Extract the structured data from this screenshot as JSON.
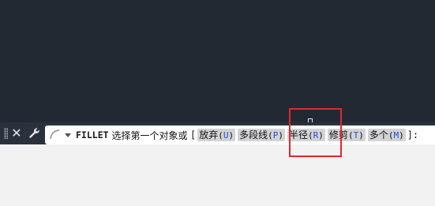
{
  "command_line": {
    "command": "FILLET",
    "prompt": "选择第一个对象或",
    "open_bracket": "[",
    "options": [
      {
        "label": "放弃",
        "key": "U"
      },
      {
        "label": "多段线",
        "key": "P"
      },
      {
        "label": "半径",
        "key": "R"
      },
      {
        "label": "修剪",
        "key": "T"
      },
      {
        "label": "多个",
        "key": "M"
      }
    ],
    "tail": "]:"
  },
  "icons": {
    "close": "close-icon",
    "customize": "wrench-icon",
    "recent": "recent-commands-icon",
    "dropdown": "chevron-down-icon"
  },
  "colors": {
    "canvas": "#222933",
    "cmdbar": "#2b313c",
    "option_key": "#1d4fd6",
    "highlight": "#e0282c"
  }
}
